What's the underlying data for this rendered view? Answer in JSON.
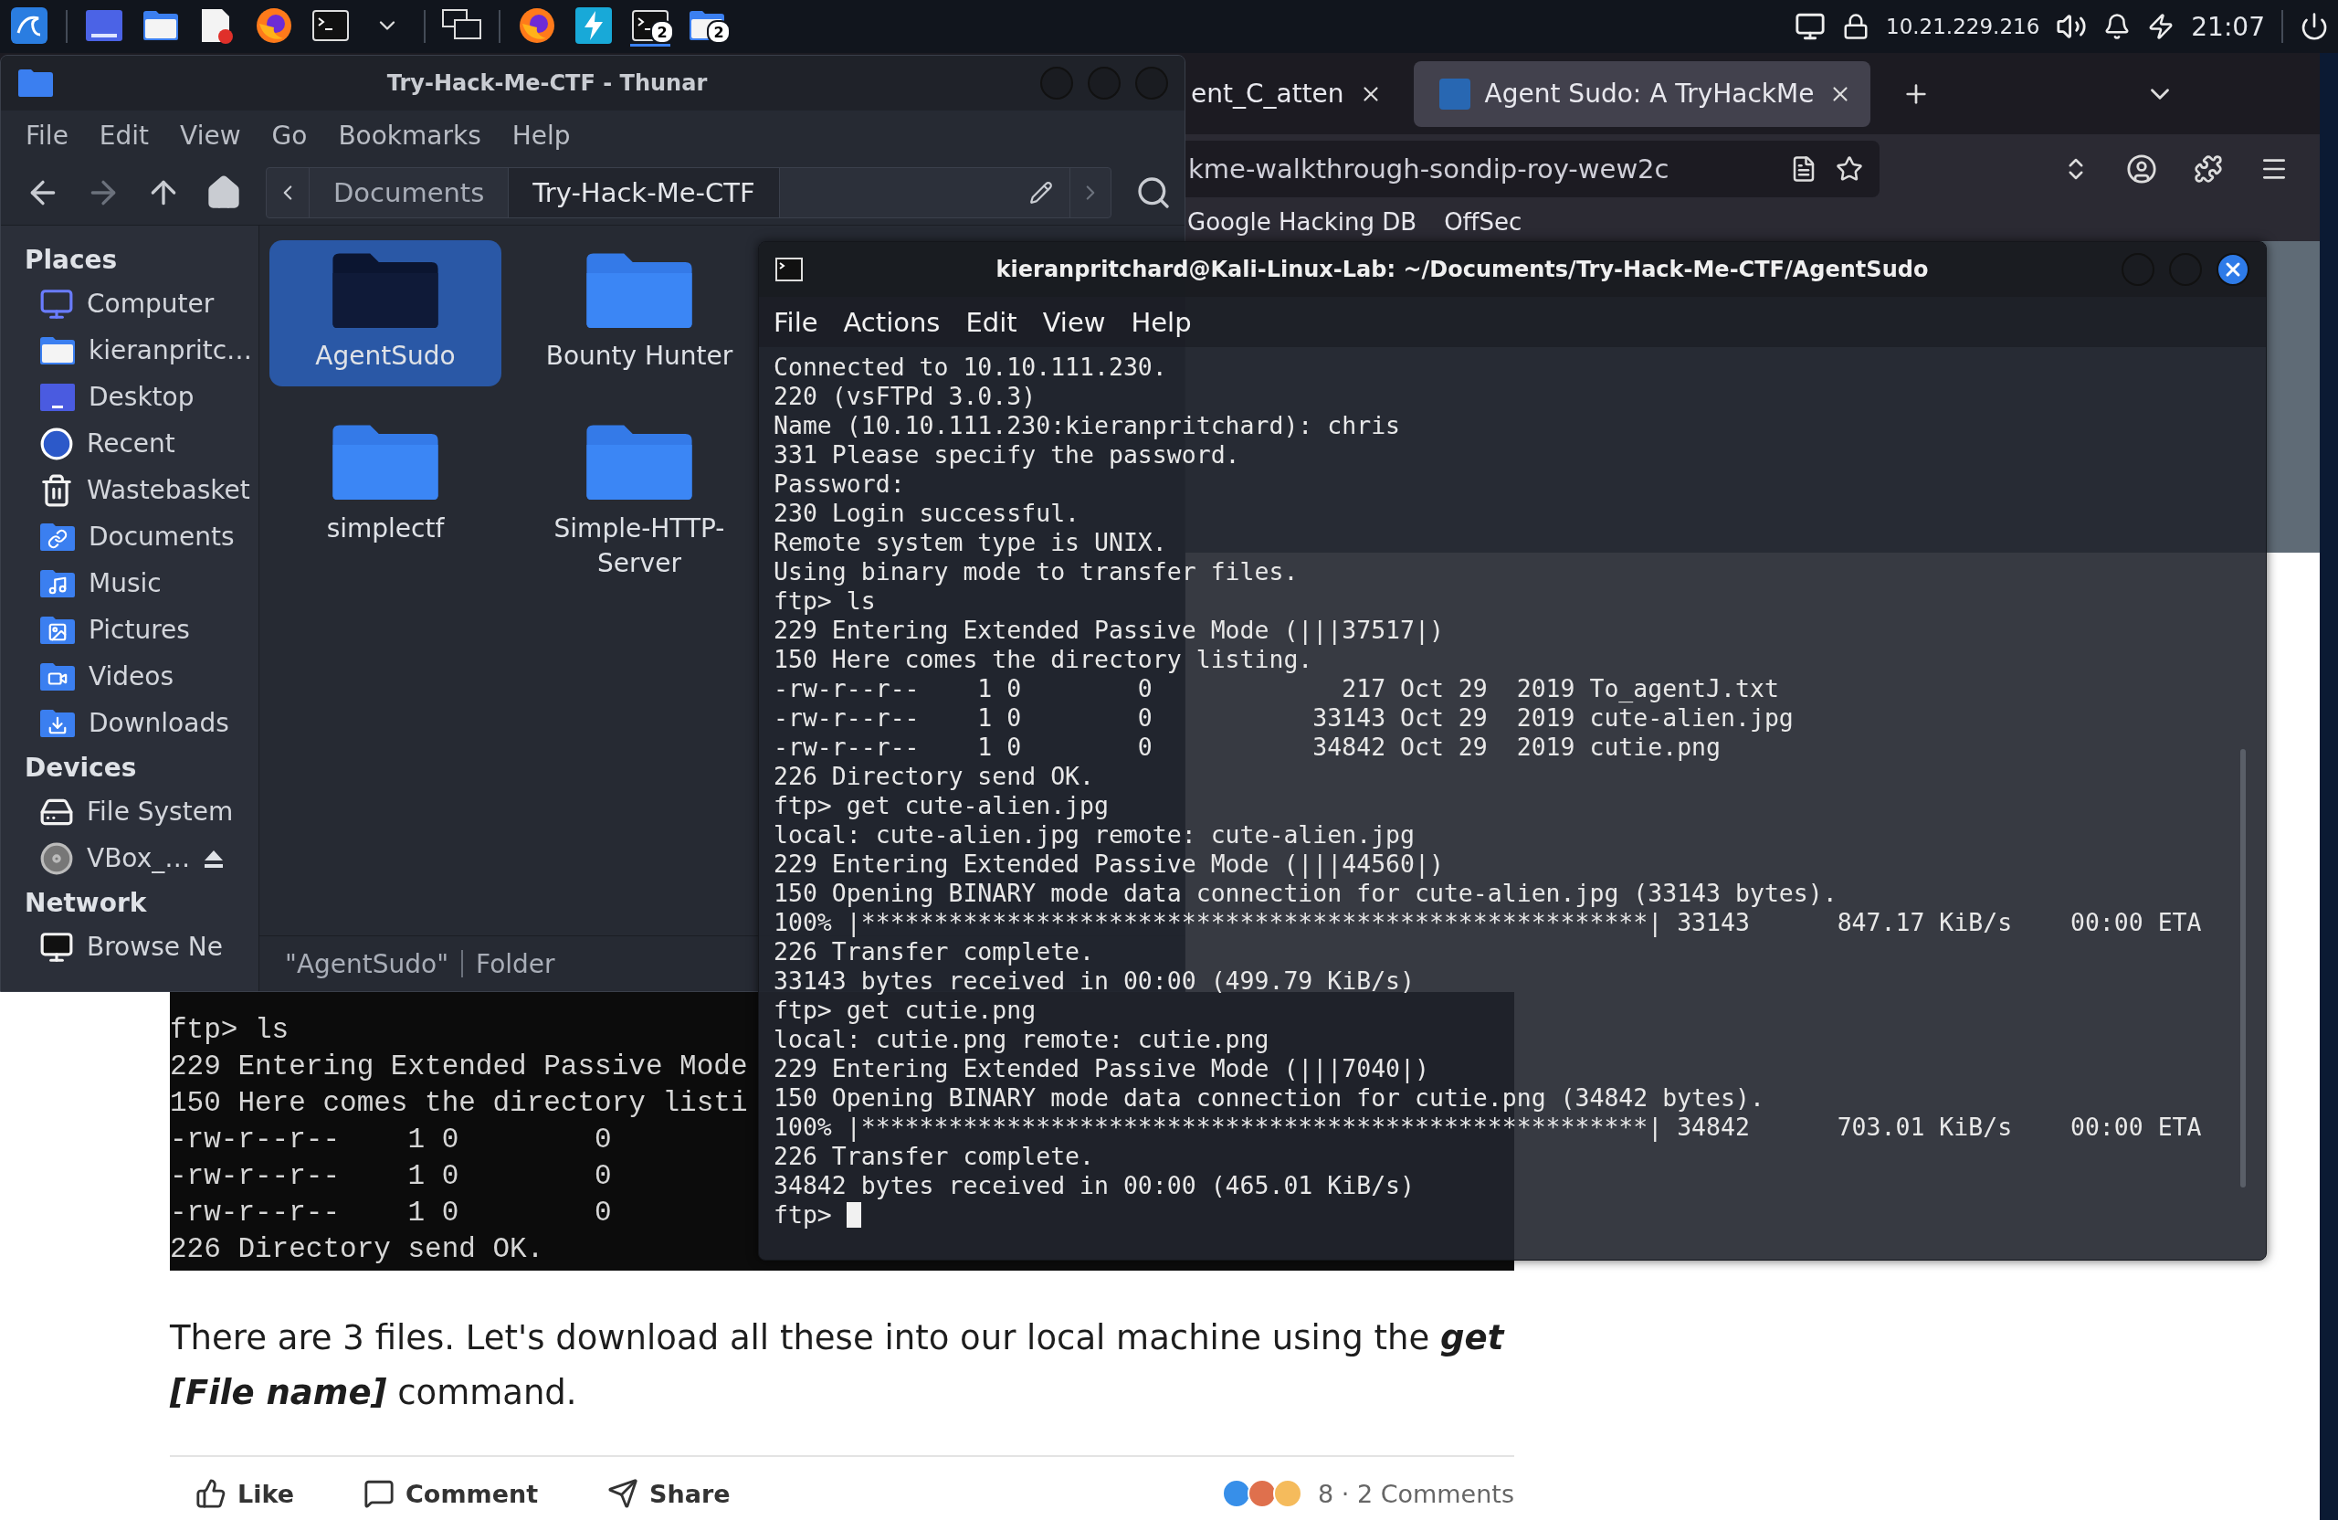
{
  "taskbar": {
    "launchers": [
      {
        "kind": "menu"
      },
      {
        "kind": "desktop"
      },
      {
        "kind": "files"
      },
      {
        "kind": "editor"
      },
      {
        "kind": "firefox"
      },
      {
        "kind": "terminal"
      },
      {
        "kind": "dropdown"
      },
      {
        "kind": "workspaces"
      }
    ],
    "tasks": [
      {
        "kind": "firefox",
        "selected": false
      },
      {
        "kind": "bolt",
        "selected": false
      },
      {
        "kind": "terminal",
        "badge": "2",
        "selected": true
      },
      {
        "kind": "files",
        "badge": "2",
        "selected": false
      }
    ],
    "ip": "10.21.229.216",
    "time": "21:07"
  },
  "browser": {
    "tabs": [
      {
        "title": "ent_C_atten",
        "selected": false
      },
      {
        "title": "Agent Sudo: A TryHackMe",
        "selected": true
      }
    ],
    "url": "kme-walkthrough-sondip-roy-wew2c",
    "bookmarks": [
      "Google Hacking DB",
      "OffSec"
    ],
    "article": {
      "image_lines": [
        "ftp> ls",
        "229 Entering Extended Passive Mode",
        "150 Here comes the directory listi",
        "-rw-r--r--    1 0        0",
        "-rw-r--r--    1 0        0",
        "-rw-r--r--    1 0        0",
        "226 Directory send OK."
      ],
      "paragraph": "There are 3 files. Let's download all these into our local machine using the **get [File name]** command.",
      "actions": [
        {
          "kind": "like",
          "label": "Like"
        },
        {
          "kind": "comment",
          "label": "Comment"
        },
        {
          "kind": "share",
          "label": "Share"
        }
      ],
      "social": "8 · 2 Comments"
    }
  },
  "thunar": {
    "title": "Try-Hack-Me-CTF - Thunar",
    "menus": [
      "File",
      "Edit",
      "View",
      "Go",
      "Bookmarks",
      "Help"
    ],
    "path": [
      {
        "label": "Documents",
        "selected": false
      },
      {
        "label": "Try-Hack-Me-CTF",
        "selected": true
      }
    ],
    "sidebar": [
      {
        "heading": "Places",
        "items": [
          {
            "label": "Computer",
            "kind": "computer"
          },
          {
            "label": "kieranpritc…",
            "kind": "home"
          },
          {
            "label": "Desktop",
            "kind": "desktop"
          },
          {
            "label": "Recent",
            "kind": "recent"
          },
          {
            "label": "Wastebasket",
            "kind": "trash"
          },
          {
            "label": "Documents",
            "kind": "documents"
          },
          {
            "label": "Music",
            "kind": "music"
          },
          {
            "label": "Pictures",
            "kind": "pictures"
          },
          {
            "label": "Videos",
            "kind": "videos"
          },
          {
            "label": "Downloads",
            "kind": "downloads"
          }
        ]
      },
      {
        "heading": "Devices",
        "items": [
          {
            "label": "File System",
            "kind": "drive"
          },
          {
            "label": "VBox_…",
            "kind": "disc"
          }
        ]
      },
      {
        "heading": "Network",
        "items": [
          {
            "label": "Browse Ne",
            "kind": "network"
          }
        ]
      }
    ],
    "items": [
      {
        "name": "AgentSudo",
        "selected": true
      },
      {
        "name": "Bounty Hunter",
        "selected": false
      },
      {
        "name": "simplectf",
        "selected": false
      },
      {
        "name": "Simple-HTTP-Server",
        "selected": false
      }
    ],
    "status": [
      "\"AgentSudo\"",
      "Folder"
    ]
  },
  "terminal": {
    "title": "kieranpritchard@Kali-Linux-Lab: ~/Documents/Try-Hack-Me-CTF/AgentSudo",
    "menus": [
      "File",
      "Actions",
      "Edit",
      "View",
      "Help"
    ],
    "lines": [
      "Connected to 10.10.111.230.",
      "220 (vsFTPd 3.0.3)",
      "Name (10.10.111.230:kieranpritchard): chris",
      "331 Please specify the password.",
      "Password:",
      "230 Login successful.",
      "Remote system type is UNIX.",
      "Using binary mode to transfer files.",
      "ftp> ls",
      "229 Entering Extended Passive Mode (|||37517|)",
      "150 Here comes the directory listing.",
      "-rw-r--r--    1 0        0             217 Oct 29  2019 To_agentJ.txt",
      "-rw-r--r--    1 0        0           33143 Oct 29  2019 cute-alien.jpg",
      "-rw-r--r--    1 0        0           34842 Oct 29  2019 cutie.png",
      "226 Directory send OK.",
      "ftp> get cute-alien.jpg",
      "local: cute-alien.jpg remote: cute-alien.jpg",
      "229 Entering Extended Passive Mode (|||44560|)",
      "150 Opening BINARY mode data connection for cute-alien.jpg (33143 bytes).",
      "100% |******************************************************| 33143      847.17 KiB/s    00:00 ETA",
      "226 Transfer complete.",
      "33143 bytes received in 00:00 (499.79 KiB/s)",
      "ftp> get cutie.png",
      "local: cutie.png remote: cutie.png",
      "229 Entering Extended Passive Mode (|||7040|)",
      "150 Opening BINARY mode data connection for cutie.png (34842 bytes).",
      "100% |******************************************************| 34842      703.01 KiB/s    00:00 ETA",
      "226 Transfer complete.",
      "34842 bytes received in 00:00 (465.01 KiB/s)",
      "ftp> "
    ]
  }
}
